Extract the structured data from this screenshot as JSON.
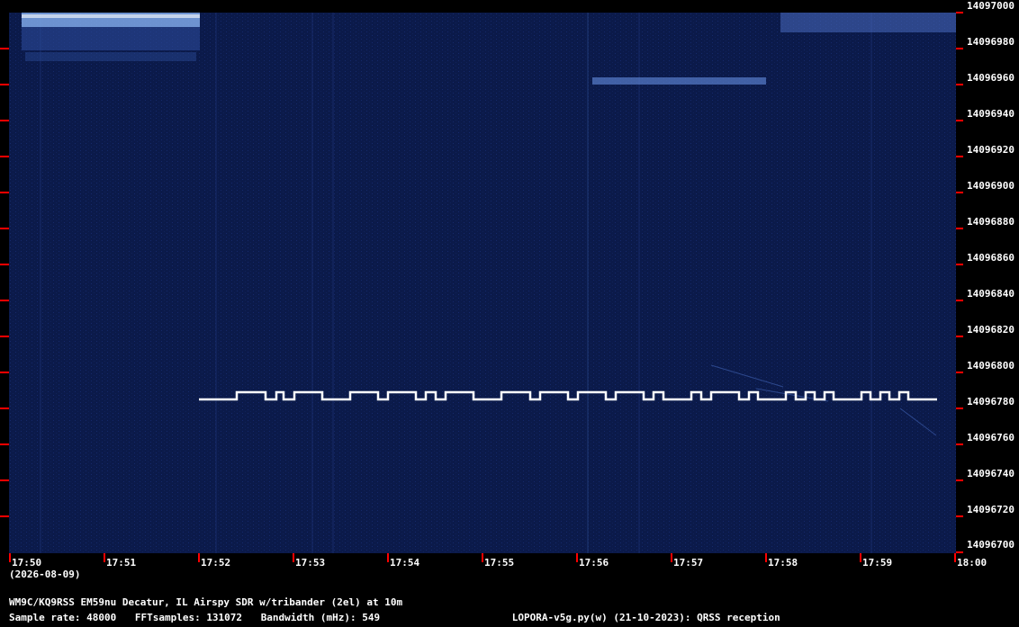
{
  "date": "(2026-08-09)",
  "frequency_labels": [
    "14097000",
    "14096980",
    "14096960",
    "14096940",
    "14096920",
    "14096900",
    "14096880",
    "14096860",
    "14096840",
    "14096820",
    "14096800",
    "14096780",
    "14096760",
    "14096740",
    "14096720",
    "14096700"
  ],
  "time_labels": [
    "17:50",
    "17:51",
    "17:52",
    "17:53",
    "17:54",
    "17:55",
    "17:56",
    "17:57",
    "17:58",
    "17:59",
    "18:00"
  ],
  "station_info": "WM9C/KQ9RSS EM59nu Decatur, IL  Airspy SDR w/tribander (2el) at 10m",
  "sample_rate": "Sample rate: 48000",
  "fft_samples": "FFTsamples: 131072",
  "bandwidth": "Bandwidth (mHz): 549",
  "software": "LOPORA-v5g.py(w) (21-10-2023): QRSS reception",
  "colors": {
    "background": "#000000",
    "waterfall": "#0b1a4a",
    "signal": "#ffffff",
    "tick": "#ff0000"
  }
}
